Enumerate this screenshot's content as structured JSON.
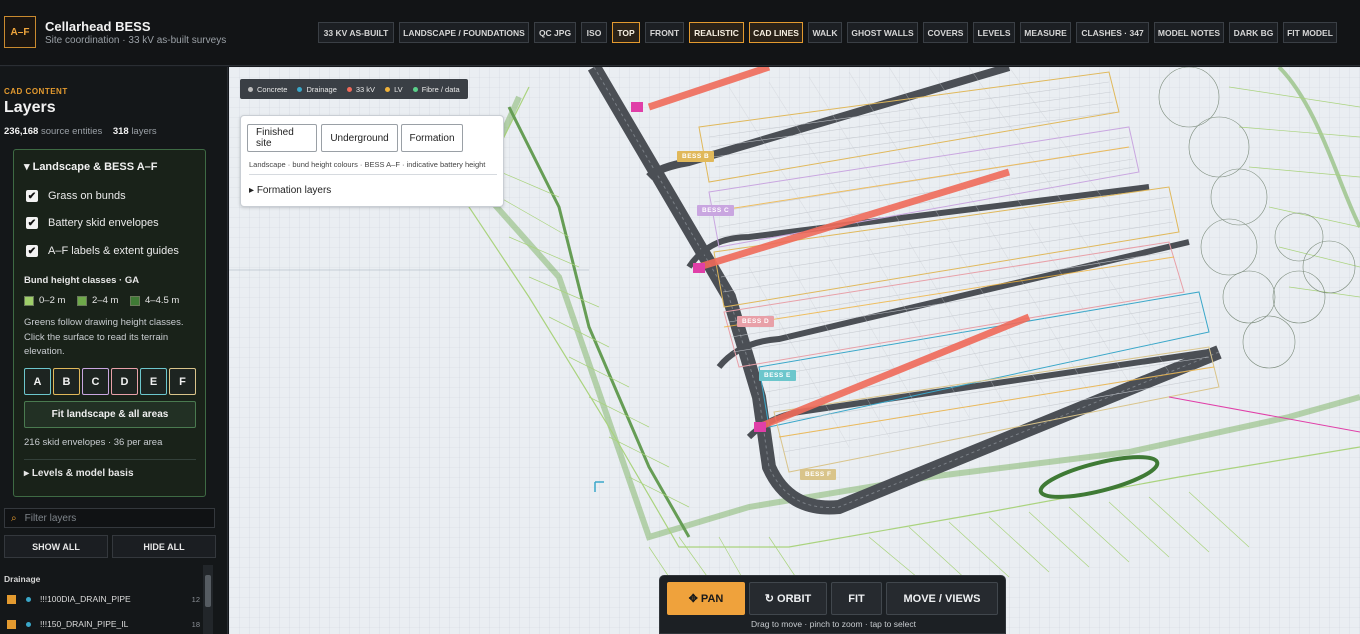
{
  "brand": {
    "badge": "A–F",
    "title": "Cellarhead BESS",
    "subtitle": "Site coordination · 33 kV as-built surveys"
  },
  "toolbar": [
    {
      "label": "33 KV AS-BUILT",
      "active": false
    },
    {
      "label": "LANDSCAPE / FOUNDATIONS",
      "active": false
    },
    {
      "label": "QC JPG",
      "active": false
    },
    {
      "label": "ISO",
      "active": false
    },
    {
      "label": "TOP",
      "active": true
    },
    {
      "label": "FRONT",
      "active": false
    },
    {
      "label": "REALISTIC",
      "active": true
    },
    {
      "label": "CAD LINES",
      "active": true
    },
    {
      "label": "WALK",
      "active": false
    },
    {
      "label": "GHOST WALLS",
      "active": false
    },
    {
      "label": "COVERS",
      "active": false
    },
    {
      "label": "LEVELS",
      "active": false
    },
    {
      "label": "MEASURE",
      "active": false
    },
    {
      "label": "CLASHES · 347",
      "active": false
    },
    {
      "label": "MODEL NOTES",
      "active": false
    },
    {
      "label": "DARK BG",
      "active": false
    },
    {
      "label": "FIT MODEL",
      "active": false
    }
  ],
  "sidebar": {
    "kicker": "CAD CONTENT",
    "title": "Layers",
    "entities_count": "236,168",
    "entities_label": "source entities",
    "layers_count": "318",
    "layers_label": "layers",
    "panel": {
      "heading": "Landscape & BESS A–F",
      "checkboxes": [
        {
          "label": "Grass on bunds",
          "checked": true
        },
        {
          "label": "Battery skid envelopes",
          "checked": true
        },
        {
          "label": "A–F labels & extent guides",
          "checked": true
        }
      ],
      "bund_title": "Bund height classes · GA",
      "bund_classes": [
        {
          "label": "0–2 m",
          "color": "#9fcf6a"
        },
        {
          "label": "2–4 m",
          "color": "#6ea94a"
        },
        {
          "label": "4–4.5 m",
          "color": "#3f7a35"
        }
      ],
      "note": "Greens follow drawing height classes. Click the surface to read its terrain elevation.",
      "areas": [
        "A",
        "B",
        "C",
        "D",
        "E",
        "F"
      ],
      "fit_label": "Fit landscape & all areas",
      "skid_count": "216 skid envelopes · 36 per area",
      "footer": "Levels & model basis"
    },
    "filter_placeholder": "Filter layers",
    "show_all": "SHOW ALL",
    "hide_all": "HIDE ALL",
    "group": "Drainage",
    "layers": [
      {
        "name": "!!!100DIA_DRAIN_PIPE",
        "count": "12"
      },
      {
        "name": "!!!150_DRAIN_PIPE_IL",
        "count": "18"
      }
    ]
  },
  "viewport": {
    "legend": [
      {
        "label": "Concrete",
        "color": "#bdbdbd"
      },
      {
        "label": "Drainage",
        "color": "#3aa7c9"
      },
      {
        "label": "33 kV",
        "color": "#f06a5a"
      },
      {
        "label": "LV",
        "color": "#f0b23a"
      },
      {
        "label": "Fibre / data",
        "color": "#5ad08a"
      }
    ],
    "modes": [
      "Finished site",
      "Underground",
      "Formation"
    ],
    "mode_desc": "Landscape · bund height colours · BESS A–F · indicative battery height",
    "formation_layers": "Formation layers",
    "bess_labels": [
      {
        "text": "BESS B",
        "color": "#e0b85a"
      },
      {
        "text": "BESS C",
        "color": "#c9a6e0"
      },
      {
        "text": "BESS D",
        "color": "#e8a0a8"
      },
      {
        "text": "BESS E",
        "color": "#6cc6cc"
      },
      {
        "text": "BESS F",
        "color": "#d9c48a"
      }
    ]
  },
  "nav": {
    "buttons": [
      {
        "label": "✥ PAN",
        "active": true
      },
      {
        "label": "↻ ORBIT",
        "active": false
      },
      {
        "label": "FIT",
        "active": false
      },
      {
        "label": "MOVE / VIEWS",
        "active": false
      }
    ],
    "hint": "Drag to move · pinch to zoom · tap to select"
  }
}
